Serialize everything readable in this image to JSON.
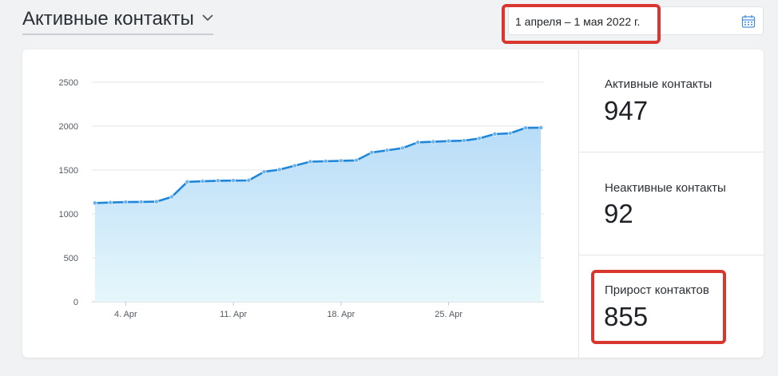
{
  "header": {
    "title": "Активные контакты",
    "date_range": "1 апреля – 1 мая 2022 г."
  },
  "stats": [
    {
      "label": "Активные контакты",
      "value": "947"
    },
    {
      "label": "Неактивные контакты",
      "value": "92"
    },
    {
      "label": "Прирост контактов",
      "value": "855"
    }
  ],
  "colors": {
    "line": "#1f87d9",
    "fill_top": "#b8dcf8",
    "fill_bottom": "#e6f7fb",
    "highlight": "#d9362f"
  },
  "chart_data": {
    "type": "area",
    "x_ticks": [
      "4. Apr",
      "11. Apr",
      "18. Apr",
      "25. Apr"
    ],
    "x_tick_days": [
      4,
      11,
      18,
      25
    ],
    "y_ticks": [
      "0",
      "500",
      "1000",
      "1500",
      "2000",
      "2500"
    ],
    "ylim": [
      0,
      2500
    ],
    "xlim": [
      1.8,
      31.2
    ],
    "grid": true,
    "points": [
      {
        "x": 2,
        "y": 1125
      },
      {
        "x": 3,
        "y": 1130
      },
      {
        "x": 4,
        "y": 1135
      },
      {
        "x": 5,
        "y": 1137
      },
      {
        "x": 6,
        "y": 1140
      },
      {
        "x": 7,
        "y": 1195
      },
      {
        "x": 8,
        "y": 1365
      },
      {
        "x": 9,
        "y": 1372
      },
      {
        "x": 10,
        "y": 1378
      },
      {
        "x": 11,
        "y": 1380
      },
      {
        "x": 12,
        "y": 1382
      },
      {
        "x": 13,
        "y": 1480
      },
      {
        "x": 14,
        "y": 1505
      },
      {
        "x": 15,
        "y": 1550
      },
      {
        "x": 16,
        "y": 1595
      },
      {
        "x": 17,
        "y": 1600
      },
      {
        "x": 18,
        "y": 1605
      },
      {
        "x": 19,
        "y": 1610
      },
      {
        "x": 20,
        "y": 1700
      },
      {
        "x": 21,
        "y": 1725
      },
      {
        "x": 22,
        "y": 1750
      },
      {
        "x": 23,
        "y": 1815
      },
      {
        "x": 24,
        "y": 1822
      },
      {
        "x": 25,
        "y": 1830
      },
      {
        "x": 26,
        "y": 1835
      },
      {
        "x": 27,
        "y": 1860
      },
      {
        "x": 28,
        "y": 1910
      },
      {
        "x": 29,
        "y": 1918
      },
      {
        "x": 30,
        "y": 1980
      },
      {
        "x": 31,
        "y": 1982
      },
      {
        "x": 32,
        "y": 1983
      }
    ]
  }
}
